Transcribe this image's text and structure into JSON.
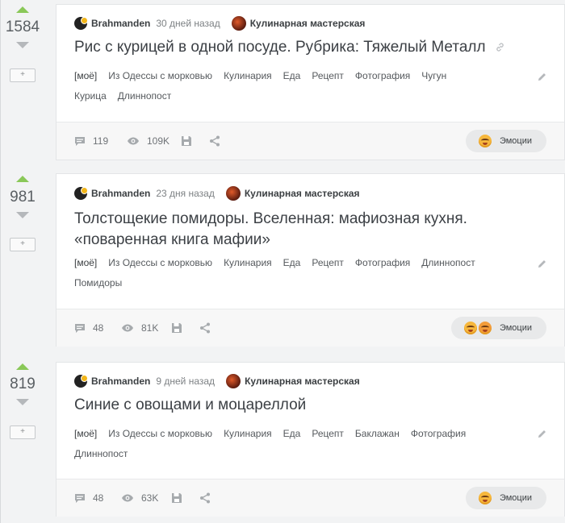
{
  "posts": [
    {
      "rating": "1584",
      "author": "Brahmanden",
      "time": "30 дней назад",
      "community": "Кулинарная мастерская",
      "title": "Рис с курицей в одной посуде. Рубрика: Тяжелый Металл",
      "tags": [
        "[моё]",
        "Из Одессы с морковью",
        "Кулинария",
        "Еда",
        "Рецепт",
        "Фотография",
        "Чугун",
        "Курица",
        "Длиннопост"
      ],
      "comments": "119",
      "views": "109K",
      "emotions_label": "Эмоции",
      "save_label": "+"
    },
    {
      "rating": "981",
      "author": "Brahmanden",
      "time": "23 дня назад",
      "community": "Кулинарная мастерская",
      "title": "Толстощекие помидоры. Вселенная: мафиозная кухня. «поваренная книга мафии»",
      "tags": [
        "[моё]",
        "Из Одессы с морковью",
        "Кулинария",
        "Еда",
        "Рецепт",
        "Фотография",
        "Длиннопост",
        "Помидоры"
      ],
      "comments": "48",
      "views": "81K",
      "emotions_label": "Эмоции",
      "save_label": "+"
    },
    {
      "rating": "819",
      "author": "Brahmanden",
      "time": "9 дней назад",
      "community": "Кулинарная мастерская",
      "title": "Синие с овощами и моцареллой",
      "tags": [
        "[моё]",
        "Из Одессы с морковью",
        "Кулинария",
        "Еда",
        "Рецепт",
        "Баклажан",
        "Фотография",
        "Длиннопост"
      ],
      "comments": "48",
      "views": "63K",
      "emotions_label": "Эмоции",
      "save_label": "+"
    }
  ],
  "colors": {
    "upvote": "#8ac858",
    "downvote": "#b5b8bb",
    "card_bg": "#ffffff",
    "page_bg": "#f2f3f4"
  },
  "icons": [
    "upvote-arrow-icon",
    "downvote-arrow-icon",
    "link-icon",
    "edit-pencil-icon",
    "comment-icon",
    "eye-icon",
    "save-floppy-icon",
    "share-icon",
    "emoji-icon"
  ]
}
